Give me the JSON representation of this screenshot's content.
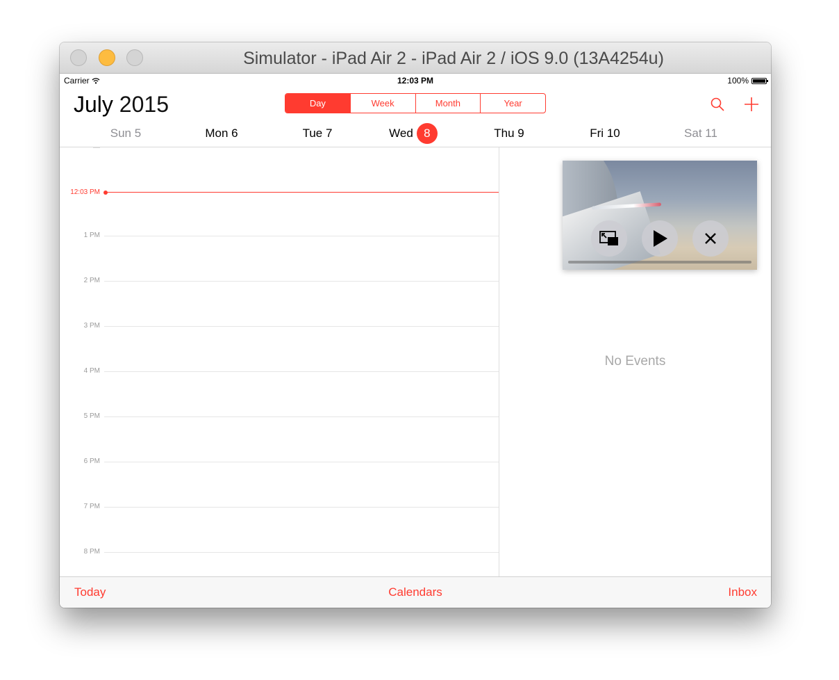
{
  "window": {
    "title": "Simulator - iPad Air 2 - iPad Air 2 / iOS 9.0 (13A4254u)"
  },
  "status_bar": {
    "carrier": "Carrier",
    "time": "12:03 PM",
    "battery": "100%"
  },
  "header": {
    "month": "July",
    "year": "2015",
    "segments": [
      "Day",
      "Week",
      "Month",
      "Year"
    ],
    "selected_segment": "Day"
  },
  "week_days": [
    {
      "name": "Sun",
      "date": "5"
    },
    {
      "name": "Mon",
      "date": "6"
    },
    {
      "name": "Tue",
      "date": "7"
    },
    {
      "name": "Wed",
      "date": "8"
    },
    {
      "name": "Thu",
      "date": "9"
    },
    {
      "name": "Fri",
      "date": "10"
    },
    {
      "name": "Sat",
      "date": "11"
    }
  ],
  "day_view": {
    "current_time": "12:03 PM",
    "hours": [
      "1 PM",
      "2 PM",
      "3 PM",
      "4 PM",
      "5 PM",
      "6 PM",
      "7 PM",
      "8 PM"
    ]
  },
  "events_panel": {
    "empty_text": "No Events"
  },
  "toolbar": {
    "today": "Today",
    "calendars": "Calendars",
    "inbox": "Inbox"
  },
  "colors": {
    "accent": "#ff3b30",
    "secondary_text": "#8e8e93",
    "window_chrome": "#d6d6d6"
  }
}
